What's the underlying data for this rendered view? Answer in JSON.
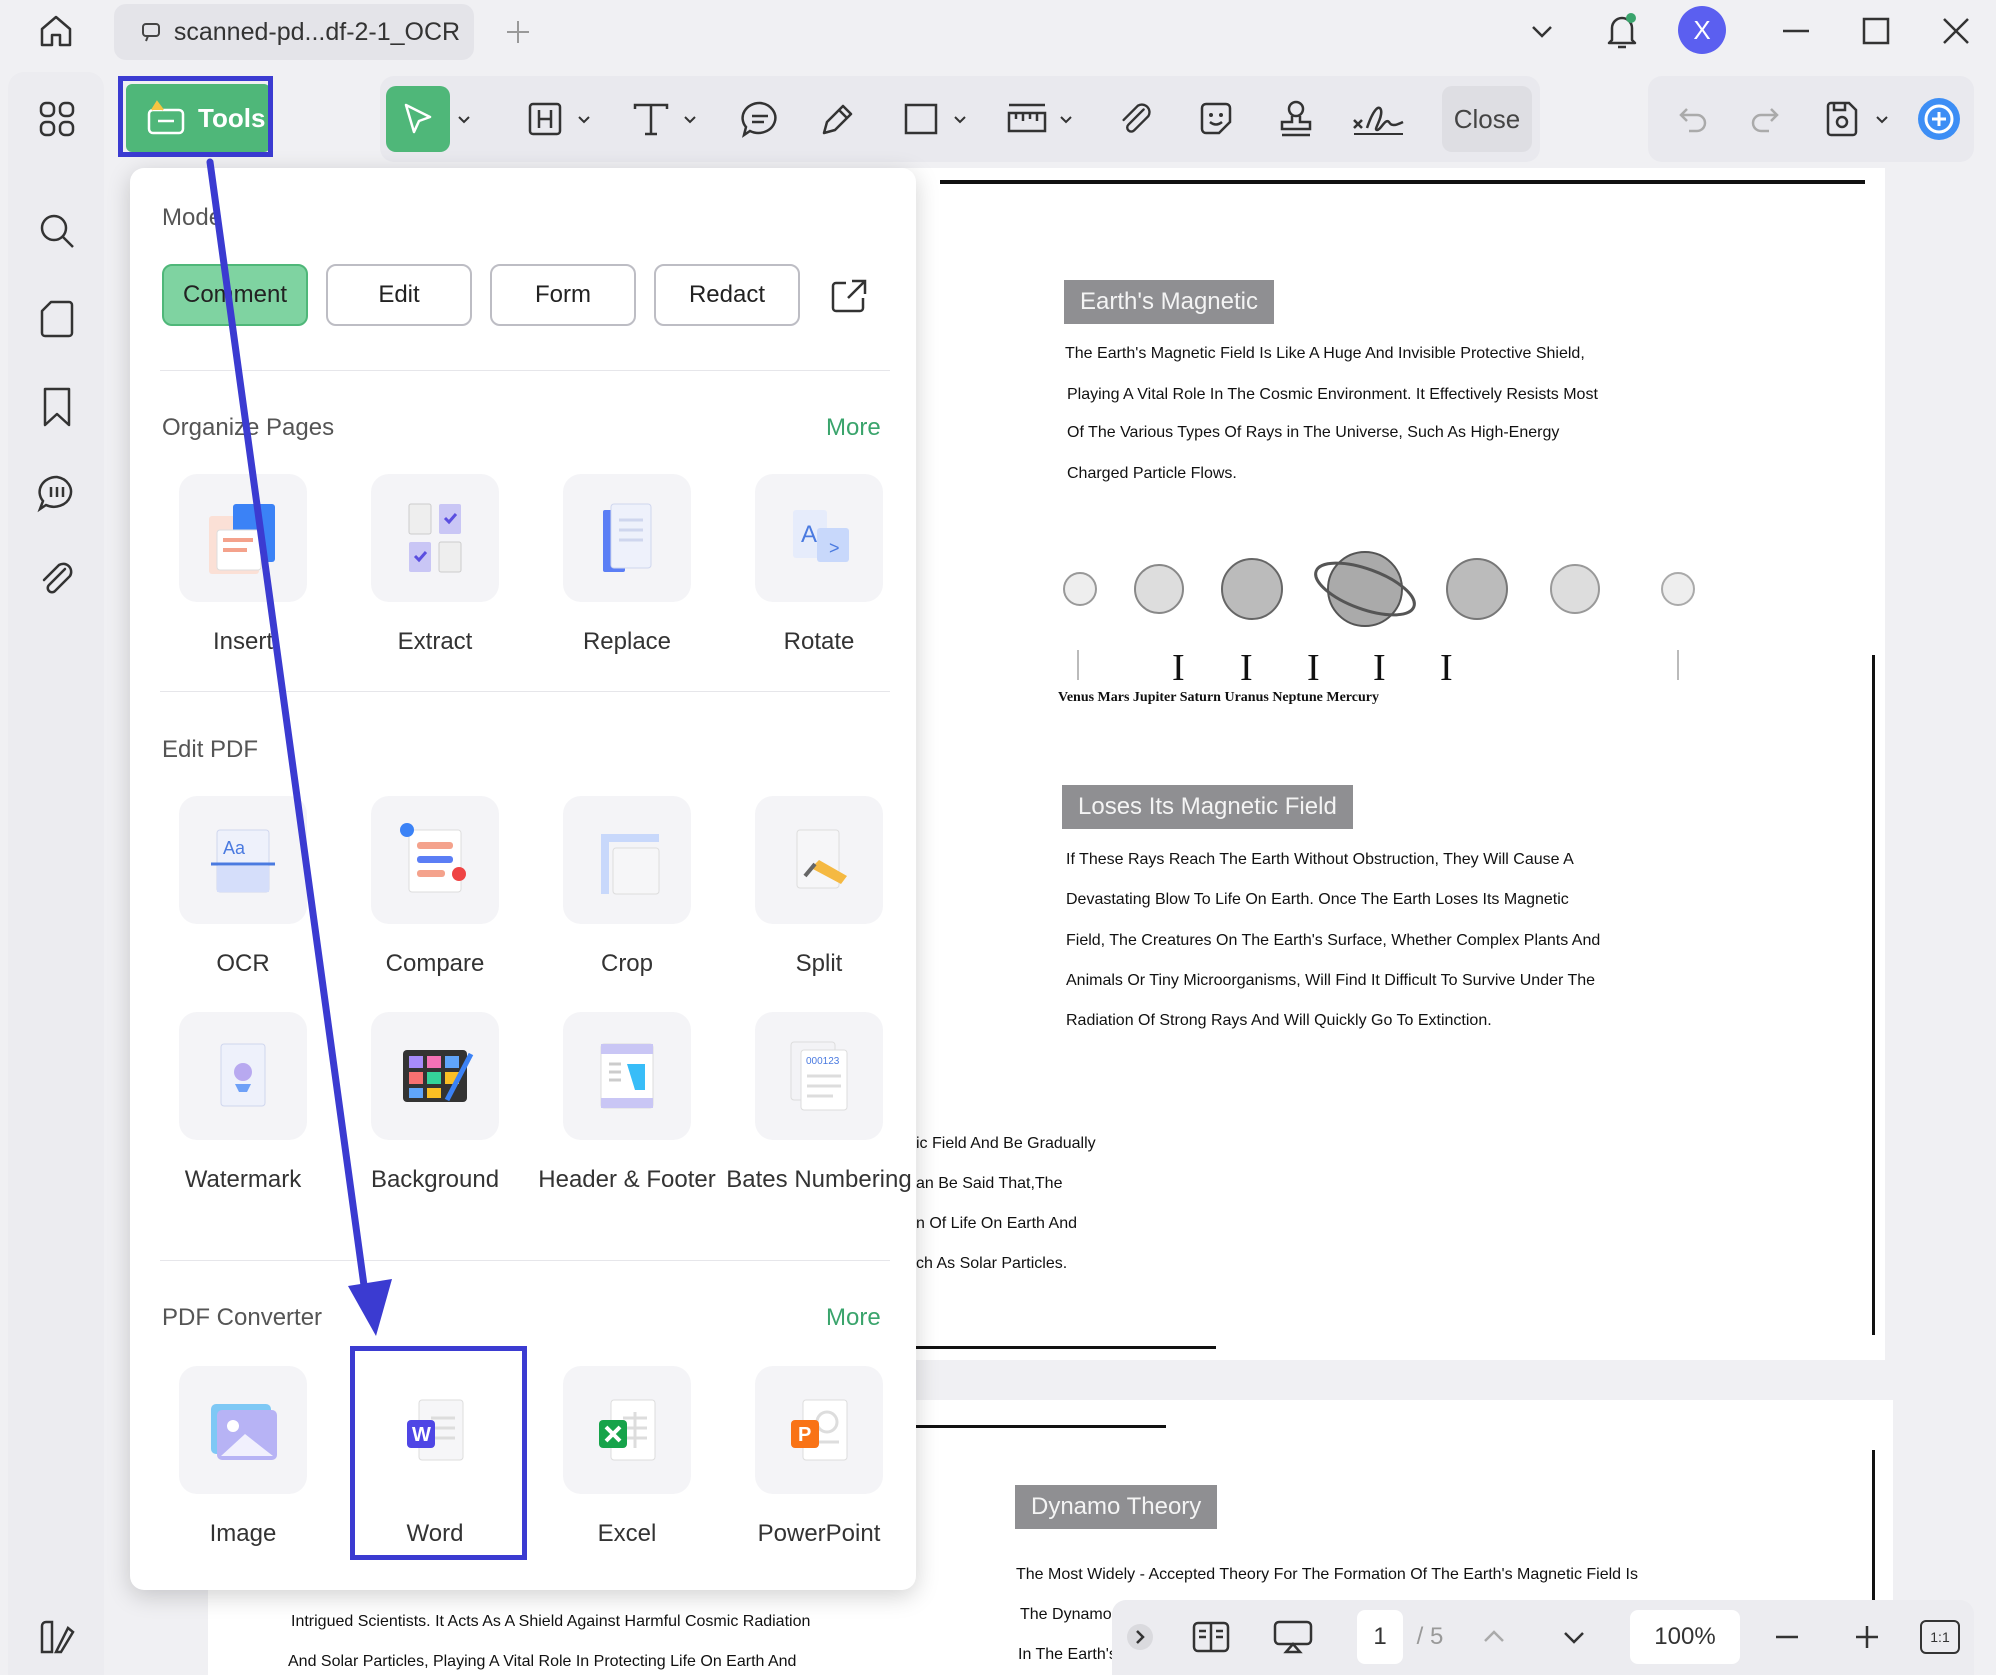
{
  "titlebar": {
    "tab_title": "scanned-pd...df-2-1_OCR",
    "avatar_letter": "X"
  },
  "toolbar": {
    "tools_label": "Tools",
    "close_label": "Close"
  },
  "panel": {
    "mode_title": "Mode",
    "modes": [
      "Comment",
      "Edit",
      "Form",
      "Redact"
    ],
    "active_mode": "Comment",
    "organize_title": "Organize Pages",
    "organize_more": "More",
    "organize_items": [
      "Insert",
      "Extract",
      "Replace",
      "Rotate"
    ],
    "edit_title": "Edit PDF",
    "edit_items_row1": [
      "OCR",
      "Compare",
      "Crop",
      "Split"
    ],
    "edit_items_row2": [
      "Watermark",
      "Background",
      "Header & Footer",
      "Bates Numbering"
    ],
    "converter_title": "PDF Converter",
    "converter_more": "More",
    "converter_items": [
      "Image",
      "Word",
      "Excel",
      "PowerPoint"
    ]
  },
  "document": {
    "heading1": "Earth's Magnetic",
    "para1": [
      "The Earth's Magnetic Field Is Like A Huge And Invisible Protective Shield,",
      "Playing A Vital Role In The Cosmic Environment. It Effectively Resists Most",
      "Of The Various Types Of Rays in The Universe, Such As High-Energy",
      "Charged Particle Flows."
    ],
    "planet_labels": "Venus Mars Jupiter Saturn Uranus Neptune Mercury",
    "heading2": "Loses Its Magnetic Field",
    "para2": [
      "If These Rays Reach The Earth Without Obstruction, They Will Cause A",
      "Devastating Blow To Life On Earth. Once The Earth Loses Its Magnetic",
      "Field, The Creatures On The Earth's Surface, Whether Complex Plants And",
      "Animals Or Tiny Microorganisms, Will Find It Difficult To Survive Under The",
      "Radiation Of Strong Rays And Will Quickly Go To Extinction."
    ],
    "para3": [
      "ic Field And Be Gradually",
      "an Be Said That,The",
      "n Of Life On Earth And",
      "ch As Solar Particles."
    ],
    "heading3": "Dynamo Theory",
    "para4": [
      "The Most Widely - Accepted Theory For The Formation Of The Earth's Magnetic Field Is",
      "The Dynamo",
      "In The Earth's"
    ],
    "para5": [
      "Intrigued Scientists. It Acts As A Shield Against Harmful Cosmic Radiation",
      "And Solar Particles, Playing A Vital Role In Protecting Life On Earth And"
    ]
  },
  "bottombar": {
    "page_current": "1",
    "page_total": "/ 5",
    "zoom": "100%",
    "fit_label": "1:1"
  },
  "colors": {
    "accent_green": "#4fb779",
    "highlight_blue": "#3b3bd1",
    "avatar": "#5b5ff0"
  }
}
